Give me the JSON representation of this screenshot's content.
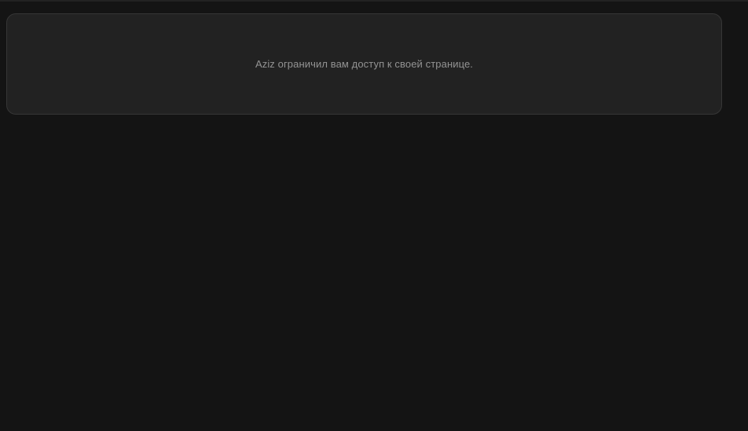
{
  "notice": {
    "message": "Aziz ограничил вам доступ к своей странице."
  },
  "colors": {
    "background": "#141414",
    "card_background": "#222222",
    "card_border": "#363636",
    "text_muted": "#939393"
  }
}
